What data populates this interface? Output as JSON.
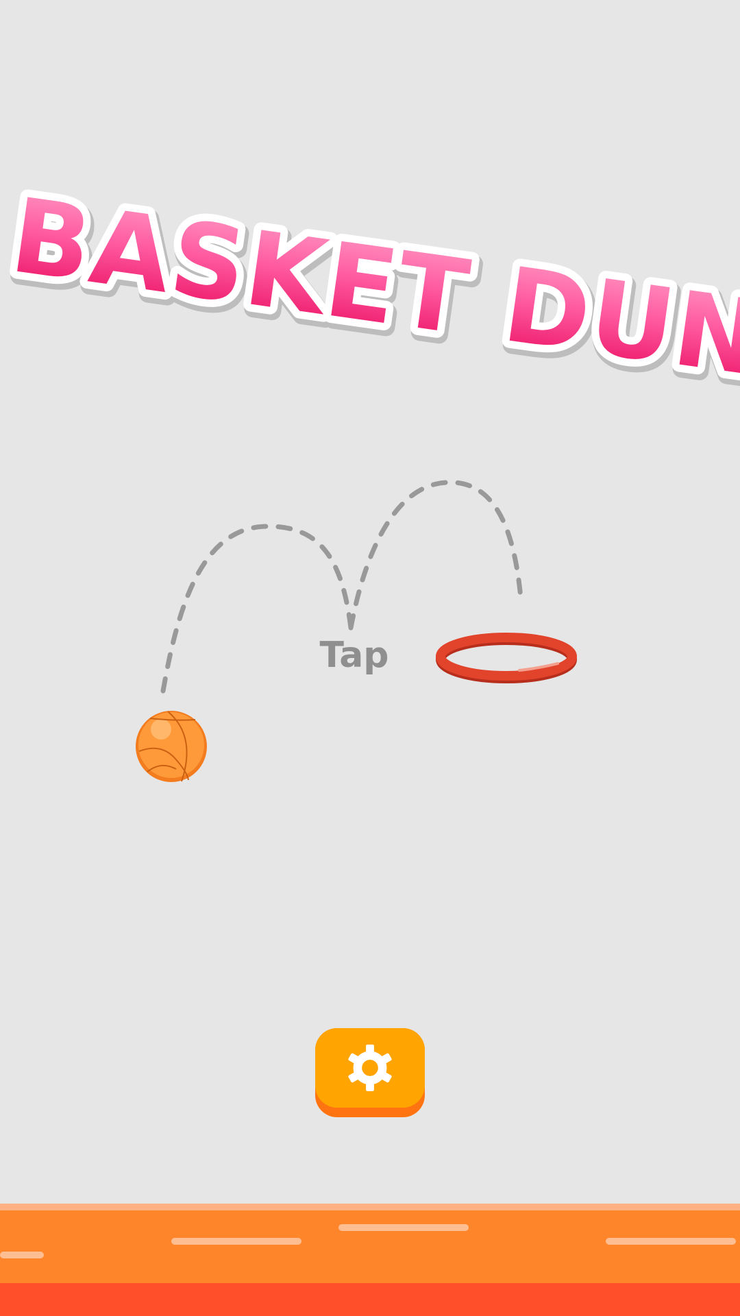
{
  "game": {
    "title": "BASKET DUNK",
    "instruction": "Tap"
  },
  "buttons": {
    "settings_icon": "gear-icon"
  },
  "colors": {
    "background": "#e6e6e6",
    "title_pink": "#f0267a",
    "title_pink_light": "#ff8fbd",
    "trajectory_dash": "#999999",
    "hoop_red": "#e2432b",
    "ball_orange": "#ff8a2a",
    "settings_button": "#ffa400",
    "ground_orange": "#ff852a",
    "ground_red": "#ff4f2a"
  }
}
